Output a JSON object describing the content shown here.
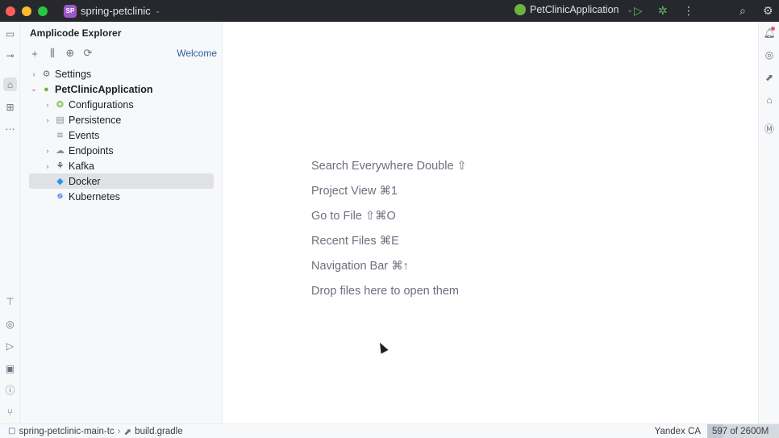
{
  "titlebar": {
    "project_badge": "SP",
    "project_name": "spring-petclinic",
    "run_config": "PetClinicApplication",
    "icons": [
      "chevron-down-icon",
      "run-icon",
      "debug-icon",
      "more-icon",
      "search-icon",
      "settings-icon"
    ]
  },
  "explorer": {
    "title": "Amplicode Explorer",
    "welcome_link": "Welcome",
    "toolbar_icons": [
      "add-icon",
      "structure-icon",
      "target-icon",
      "refresh-icon"
    ],
    "tree": [
      {
        "label": "Settings",
        "level": 0,
        "expandable": true,
        "expanded": false,
        "icon": "gear-icon"
      },
      {
        "label": "PetClinicApplication",
        "level": 0,
        "expandable": true,
        "expanded": true,
        "icon": "spring-app-icon",
        "bold": true
      },
      {
        "label": "Configurations",
        "level": 1,
        "expandable": true,
        "expanded": false,
        "icon": "config-icon"
      },
      {
        "label": "Persistence",
        "level": 1,
        "expandable": true,
        "expanded": false,
        "icon": "persistence-icon"
      },
      {
        "label": "Events",
        "level": 1,
        "expandable": false,
        "icon": "events-icon"
      },
      {
        "label": "Endpoints",
        "level": 1,
        "expandable": true,
        "expanded": false,
        "icon": "endpoints-icon"
      },
      {
        "label": "Kafka",
        "level": 1,
        "expandable": true,
        "expanded": false,
        "icon": "kafka-icon"
      },
      {
        "label": "Docker",
        "level": 1,
        "expandable": false,
        "icon": "docker-icon",
        "selected": true
      },
      {
        "label": "Kubernetes",
        "level": 1,
        "expandable": false,
        "icon": "kubernetes-icon"
      }
    ]
  },
  "editor": {
    "hints": [
      "Search Everywhere Double ⇧",
      "Project View ⌘1",
      "Go to File ⇧⌘O",
      "Recent Files ⌘E",
      "Navigation Bar ⌘↑",
      "Drop files here to open them"
    ]
  },
  "statusbar": {
    "module": "spring-petclinic-main-tc",
    "file": "build.gradle",
    "vcs": "Yandex CA",
    "memory": "597 of 2600M",
    "memory_fraction": 0.23
  },
  "colors": {
    "titlebar_bg": "#27282e",
    "panel_bg": "#f7f8fa",
    "link": "#2f5e99",
    "selection": "#dfe1e5",
    "spring_green": "#6db33f"
  }
}
